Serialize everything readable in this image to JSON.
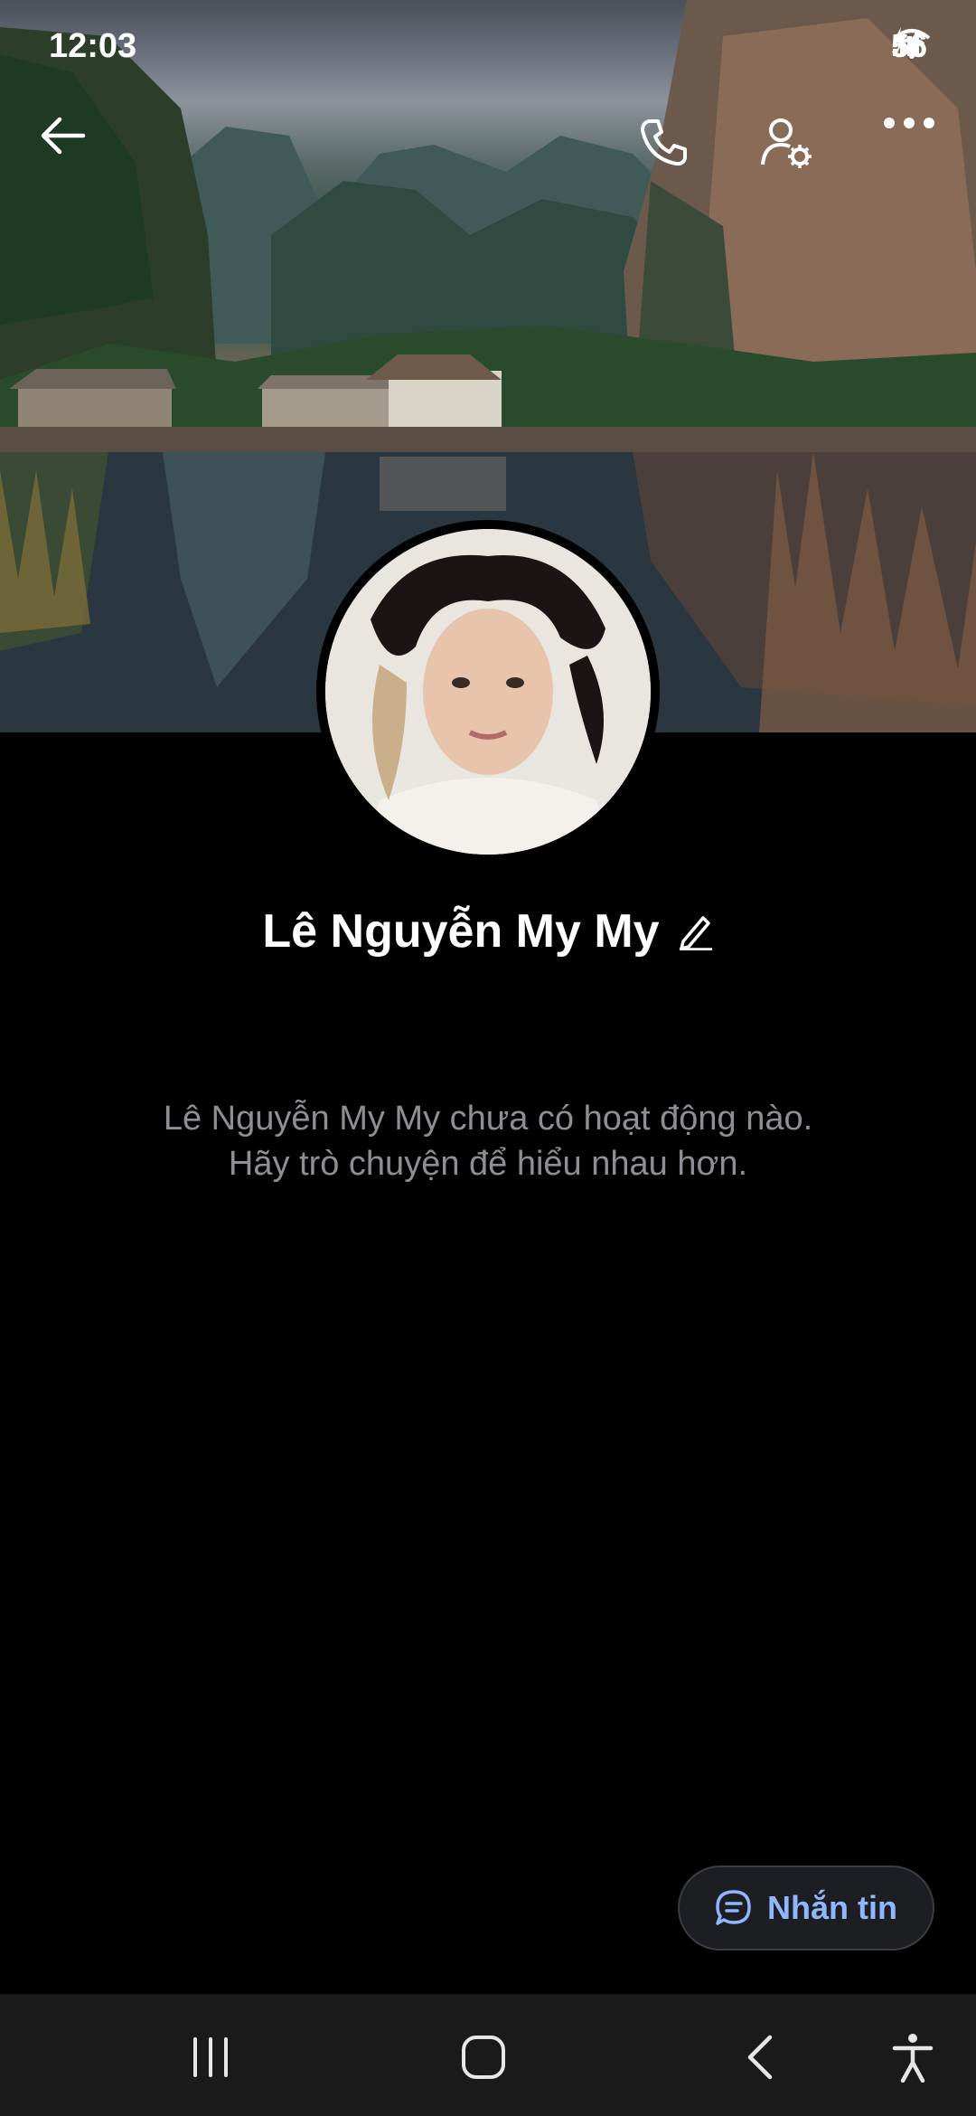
{
  "status_bar": {
    "time": "12:03",
    "battery": "56"
  },
  "profile": {
    "name": "Lê Nguyễn My My",
    "empty_line1": "Lê Nguyễn My My chưa có hoạt động nào.",
    "empty_line2": "Hãy trò chuyện để hiểu nhau hơn."
  },
  "actions": {
    "message_label": "Nhắn tin"
  },
  "icons": {
    "back": "back-arrow-icon",
    "call": "phone-icon",
    "settings": "user-settings-icon",
    "more": "more-icon",
    "edit": "pencil-icon",
    "chat": "chat-bubble-icon"
  },
  "colors": {
    "accent": "#8fb6ff",
    "muted_text": "#8d8f94",
    "background": "#000000"
  }
}
